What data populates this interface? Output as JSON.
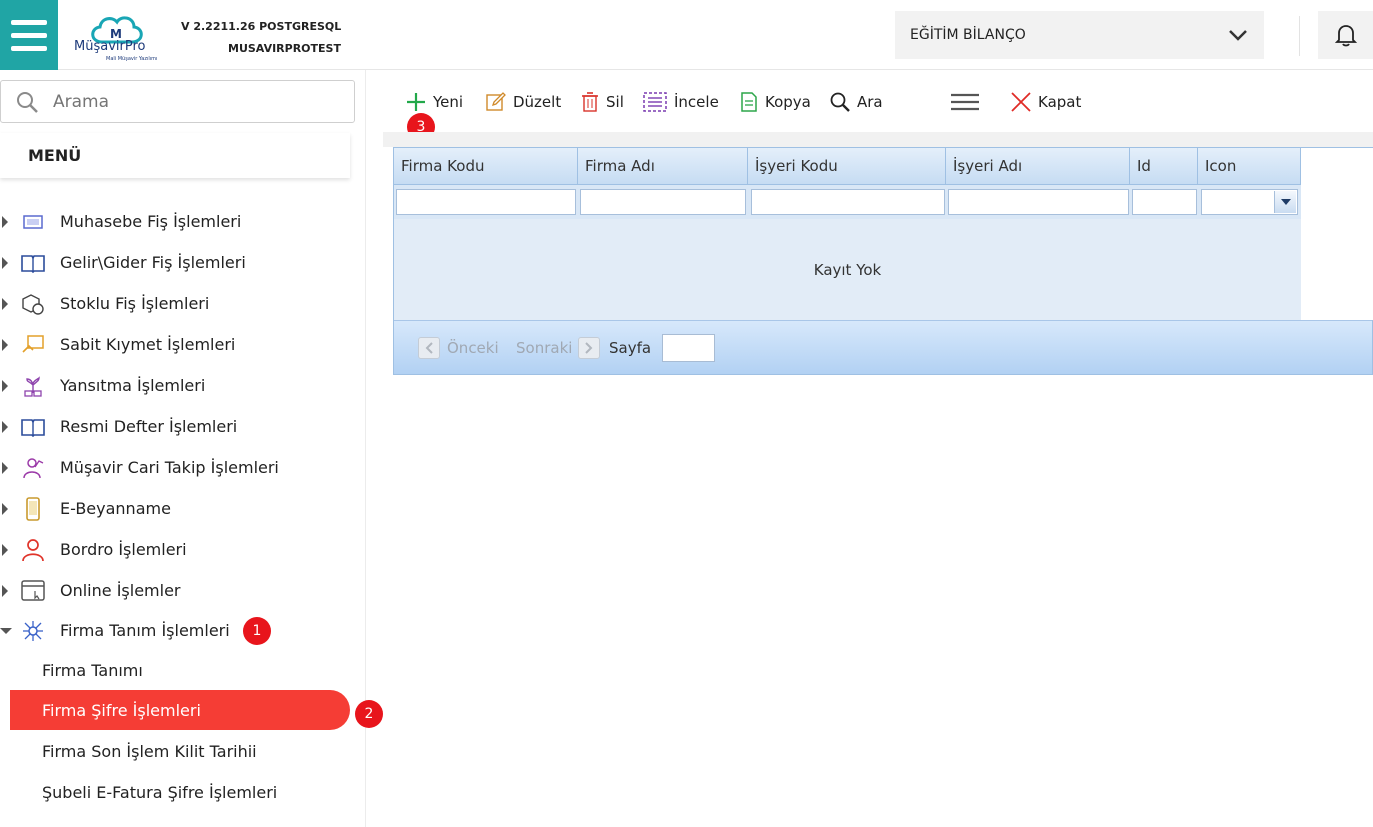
{
  "header": {
    "logo_text": "MüşavirPro",
    "logo_sub": "Mali Müşavir Yazılımı",
    "version": "V 2.2211.26 POSTGRESQL",
    "database": "MUSAVIRPROTEST",
    "company_selected": "EĞİTİM BİLANÇO"
  },
  "sidebar": {
    "search_placeholder": "Arama",
    "menu_title": "MENÜ",
    "items": [
      {
        "label": "Muhasebe Fiş İşlemleri",
        "icon": "receipt-icon"
      },
      {
        "label": "Gelir\\Gider Fiş İşlemleri",
        "icon": "book-icon"
      },
      {
        "label": "Stoklu Fiş İşlemleri",
        "icon": "box-icon"
      },
      {
        "label": "Sabit Kıymet İşlemleri",
        "icon": "asset-icon"
      },
      {
        "label": "Yansıtma İşlemleri",
        "icon": "plant-icon"
      },
      {
        "label": "Resmi Defter İşlemleri",
        "icon": "ledger-icon"
      },
      {
        "label": "Müşavir Cari Takip İşlemleri",
        "icon": "person-chart-icon"
      },
      {
        "label": "E-Beyanname",
        "icon": "phone-icon"
      },
      {
        "label": "Bordro İşlemleri",
        "icon": "user-icon"
      },
      {
        "label": "Online İşlemler",
        "icon": "browser-icon"
      },
      {
        "label": "Firma Tanım İşlemleri",
        "icon": "network-icon"
      }
    ],
    "sub_items": [
      "Firma Tanımı",
      "Firma Şifre İşlemleri",
      "Firma Son İşlem Kilit Tarihii",
      "Şubeli E-Fatura Şifre İşlemleri"
    ],
    "badges": [
      "1",
      "2"
    ]
  },
  "toolbar": {
    "new": "Yeni",
    "edit": "Düzelt",
    "delete": "Sil",
    "inspect": "İncele",
    "copy": "Kopya",
    "search": "Ara",
    "close": "Kapat",
    "badge": "3"
  },
  "grid": {
    "columns": [
      "Firma Kodu",
      "Firma Adı",
      "İşyeri Kodu",
      "İşyeri Adı",
      "Id",
      "Icon"
    ],
    "empty_text": "Kayıt Yok",
    "pager": {
      "prev": "Önceki",
      "next": "Sonraki",
      "page_label": "Sayfa",
      "page_value": ""
    }
  },
  "colors": {
    "accent": "#20a5a5",
    "active": "#f53d35",
    "badge": "#e8151c",
    "grid_border": "#9fc0e3"
  }
}
